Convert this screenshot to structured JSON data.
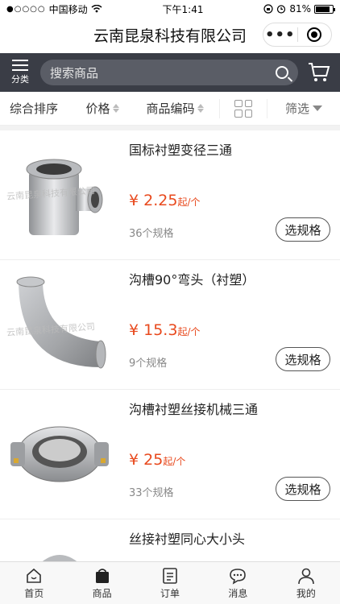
{
  "status": {
    "carrier": "中国移动",
    "time": "下午1:41",
    "battery": "81%"
  },
  "header": {
    "title": "云南昆泉科技有限公司"
  },
  "search": {
    "category_label": "分类",
    "placeholder": "搜索商品"
  },
  "sort": {
    "comprehensive": "综合排序",
    "price": "价格",
    "code": "商品编码",
    "filter": "筛选"
  },
  "watermark": "云南昆泉科技有限公司",
  "products": [
    {
      "name": "国标衬塑变径三通",
      "price": "¥ 2.25",
      "unit": "起/个",
      "specs": "36个规格",
      "button": "选规格"
    },
    {
      "name": "沟槽90°弯头（衬塑）",
      "price": "¥ 15.3",
      "unit": "起/个",
      "specs": "9个规格",
      "button": "选规格"
    },
    {
      "name": "沟槽衬塑丝接机械三通",
      "price": "¥ 25",
      "unit": "起/个",
      "specs": "33个规格",
      "button": "选规格"
    },
    {
      "name": "丝接衬塑同心大小头"
    }
  ],
  "tabs": [
    "首页",
    "商品",
    "订单",
    "消息",
    "我的"
  ]
}
